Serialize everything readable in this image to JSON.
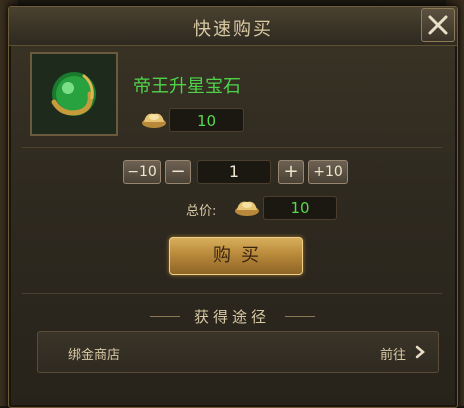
{
  "dialog": {
    "title": "快速购买",
    "close_icon": "close-icon"
  },
  "item": {
    "name": "帝王升星宝石",
    "icon": "emperor-star-gem-icon",
    "price": "10",
    "currency_icon": "gold-ingot-icon"
  },
  "quantity": {
    "minus10_label": "−10",
    "minus_label": "−",
    "value": "1",
    "plus_label": "+",
    "plus10_label": "+10"
  },
  "total": {
    "label": "总价:",
    "value": "10"
  },
  "buy_button": {
    "label": "购买"
  },
  "sources": {
    "title": "获得途径",
    "items": [
      {
        "name": "绑金商店",
        "action": "前往"
      }
    ]
  },
  "colors": {
    "item_name": "#4fd24a",
    "price_text": "#56d84f",
    "buy_button": "#c1913f",
    "title_text": "#d8c9a4"
  }
}
